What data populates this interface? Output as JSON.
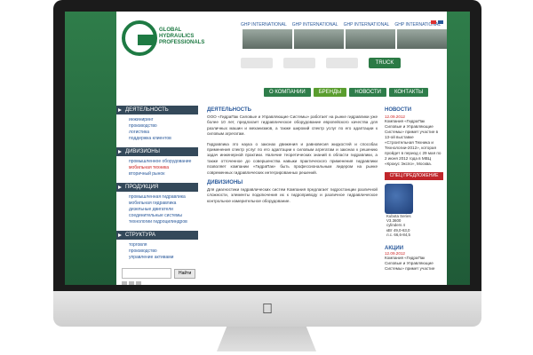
{
  "header": {
    "logo_lines": [
      "GLOBAL",
      "HYDRAULICS",
      "PROFESSIONALS"
    ],
    "top_links": [
      "GHP INTERNATIONAL",
      "GHP INTERNATIONAL",
      "GHP INTERNATIONAL",
      "GHP INTERNATIONAL"
    ],
    "brand_truck": "TRUCK HYDRA"
  },
  "nav": {
    "items": [
      "О КОМПАНИИ",
      "БРЕНДЫ",
      "НОВОСТИ",
      "КОНТАКТЫ"
    ]
  },
  "sidebar": {
    "sections": [
      {
        "title": "ДЕЯТЕЛЬНОСТЬ",
        "links": [
          "инжиниринг",
          "производство",
          "логистика",
          "поддержка клиентов"
        ]
      },
      {
        "title": "ДИВИЗИОНЫ",
        "links": [
          "промышленное оборудование",
          "мобильная техника",
          "вторичный рынок"
        ]
      },
      {
        "title": "ПРОДУКЦИЯ",
        "links": [
          "промышленная гидравлика",
          "мобильная гидравлика",
          "дизельные двигатели",
          "соединительные системы",
          "технологии гидроцилиндров"
        ]
      },
      {
        "title": "СТРУКТУРА",
        "links": [
          "торговля",
          "производство",
          "управление активами"
        ]
      }
    ],
    "search_button": "Найти"
  },
  "main": {
    "sections": [
      {
        "title": "ДЕЯТЕЛЬНОСТЬ",
        "paragraphs": [
          "ООО «ГидраПак Силовые и Управляющие Системы» работает на рынке гидравлики уже более 10 лет, предлагает гидравлическое оборудование европейского качества для различных машин и механизмов, а также широкий спектр услуг по его адаптации к силовым агрегатам.",
          "Гидравлика это наука о законах движения и равновесия жидкостей и способах применения спектр услуг по его адаптации к силовым агрегатам и законах к решению задач инженерной практики. Наличие теоретических знаний в области гидравлики, а также отточенное до совершенства навыки практического применения гидравлики позволяет компании «ГидраПак» быть профессиональным лидером на рынке современных гидравлических интегрированных решений."
        ]
      },
      {
        "title": "ДИВИЗИОНЫ",
        "paragraphs": [
          "Для диагностики гидравлических систем Компания предлагает гидростанции различной сложности, элементы подключения их к гидроприводу и различное гидравлическое контрольное измерительное оборудование."
        ]
      }
    ]
  },
  "right": {
    "news_title": "НОВОСТИ",
    "news_date": "12.09.2012",
    "news_text": "Компания «ГидраПак Силовые и Управляющие Системы» примет участие в 13-ой выставке «Строительная Техника и Технологии-2012», которая пройдет в период с 29 мая по 2 июня 2012 года в МВЦ «Крокус Экспо», Москва.",
    "special_title": "СПЕЦ ПРЕДЛОЖЕНИЕ",
    "engine_info": [
      "Kubota Series V3.3600",
      "cylinders 4",
      "кВт 49,0-63,0",
      "л.с. 66,6-84,5"
    ],
    "actions_title": "АКЦИИ",
    "action_date": "12.09.2012",
    "action_text": "Компания «ГидраПак Силовые и Управляющие Системы» примет участие"
  }
}
